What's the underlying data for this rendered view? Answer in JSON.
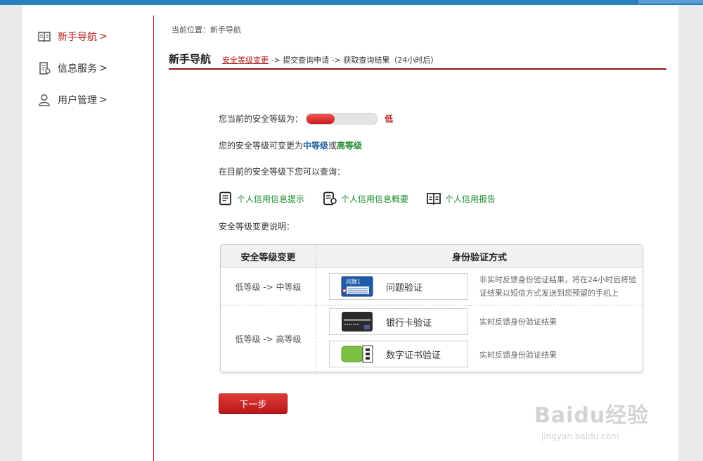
{
  "sidebar": {
    "items": [
      {
        "label": "新手导航",
        "arrow": ">",
        "icon": "open-book-icon",
        "active": true
      },
      {
        "label": "信息服务",
        "arrow": ">",
        "icon": "document-icon",
        "active": false
      },
      {
        "label": "用户管理",
        "arrow": ">",
        "icon": "user-icon",
        "active": false
      }
    ]
  },
  "breadcrumb": "当前位置：新手导航",
  "nav": {
    "title": "新手导航",
    "steps": {
      "active": "安全等级变更",
      "rest": " -> 提交查询申请 -> 获取查询结果（24小时后）"
    }
  },
  "security": {
    "current_label": "您当前的安全等级为：",
    "level_fraction": 0.4,
    "level_text": "低",
    "change_label": "您的安全等级可变更为 ",
    "option_mid": "中等级",
    "or": "或",
    "option_high": "高等级",
    "query_label": "在目前的安全等级下您可以查询：",
    "links": [
      {
        "label": "个人信用信息提示",
        "icon": "document-lines-icon"
      },
      {
        "label": "个人信用信息概要",
        "icon": "document-info-icon"
      },
      {
        "label": "个人信用报告",
        "icon": "open-book-icon"
      }
    ],
    "explain_label": "安全等级变更说明："
  },
  "table": {
    "headers": [
      "安全等级变更",
      "身份验证方式"
    ],
    "rows": [
      {
        "level": "低等级 -> 中等级",
        "methods": [
          {
            "label": "问题验证",
            "pic": "question-card",
            "pic_text": "问题1",
            "desc": "非实时反馈身份验证结果，将在24小时后将验证结果以短信方式发送到您预留的手机上"
          }
        ]
      },
      {
        "level": "低等级 -> 高等级",
        "methods": [
          {
            "label": "银行卡验证",
            "pic": "bank-card",
            "desc": "实时反馈身份验证结果"
          },
          {
            "label": "数字证书验证",
            "pic": "usb-key",
            "desc": "实时反馈身份验证结果"
          }
        ]
      }
    ]
  },
  "next_button": "下一步",
  "watermark": {
    "text": "Baidu经验",
    "url": "jingyan.baidu.com"
  },
  "colors": {
    "accent": "#b22222",
    "blue": "#1f5f9e",
    "green": "#1e8a2e",
    "topbar": "#2a7fc0"
  }
}
